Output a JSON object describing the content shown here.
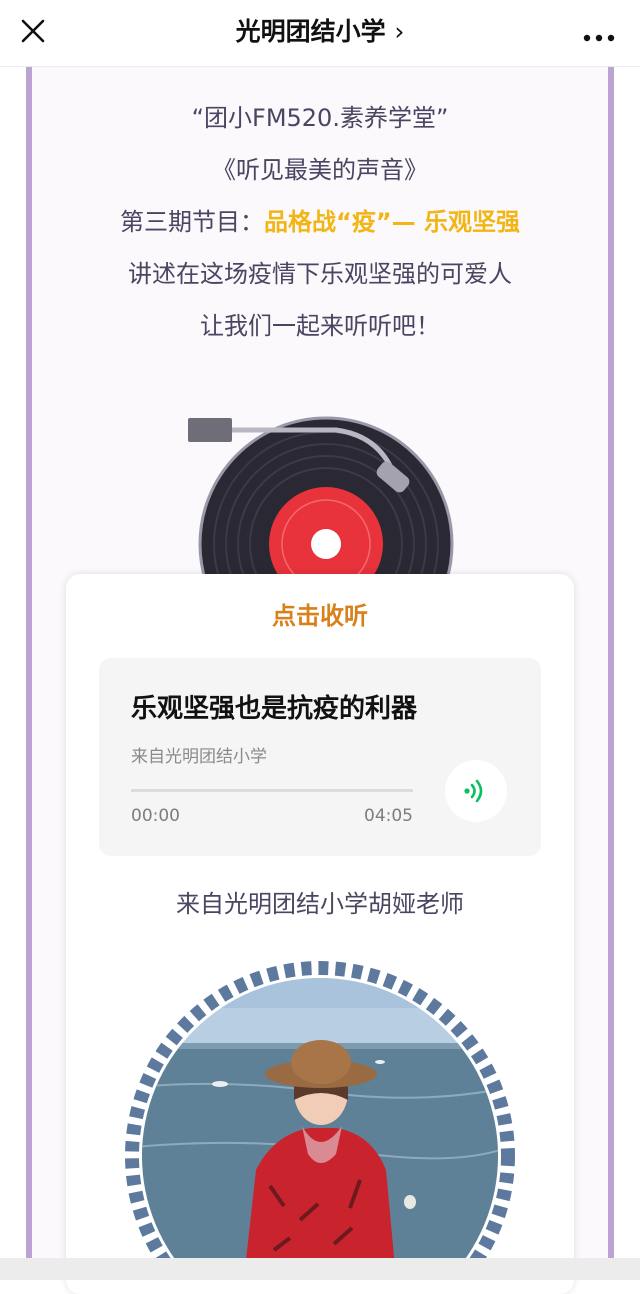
{
  "nav": {
    "title": "光明团结小学",
    "chevron": "›",
    "close_icon": "close-icon",
    "more_icon": "more-icon"
  },
  "intro": {
    "line1": "“团小FM520.素养学堂”",
    "line2": "《听见最美的声音》",
    "line3_prefix": "第三期节目：",
    "line3_highlight": "品格战“疫”— 乐观坚强",
    "line4": "讲述在这场疫情下乐观坚强的可爱人",
    "line5": "让我们一起来听听吧！"
  },
  "player": {
    "heading": "点击收听",
    "audio_title": "乐观坚强也是抗疫的利器",
    "audio_source": "来自光明团结小学",
    "time_current": "00:00",
    "time_total": "04:05",
    "progress": 0
  },
  "teacher": {
    "caption": "来自光明团结小学胡娅老师"
  },
  "colors": {
    "frame_border": "#bba4d3",
    "highlight": "#f2b514",
    "listen_heading": "#d9801a",
    "play_green": "#07c160",
    "record_red": "#e8323c"
  }
}
